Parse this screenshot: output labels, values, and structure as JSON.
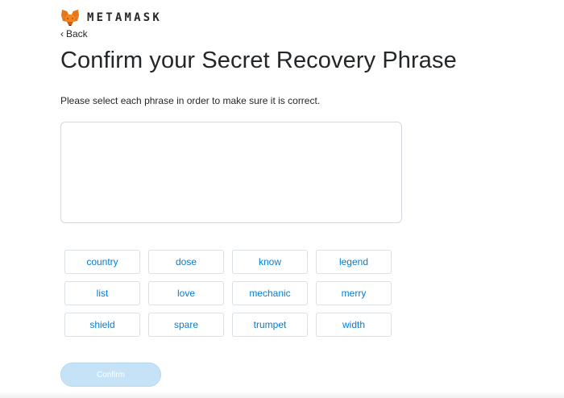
{
  "brand": {
    "wordmark": "METAMASK",
    "logo_icon": "metamask-fox-icon"
  },
  "nav": {
    "back_label": "Back",
    "back_icon": "chevron-left-icon"
  },
  "page": {
    "title": "Confirm your Secret Recovery Phrase",
    "instructions": "Please select each phrase in order to make sure it is correct."
  },
  "words": [
    "country",
    "dose",
    "know",
    "legend",
    "list",
    "love",
    "mechanic",
    "merry",
    "shield",
    "spare",
    "trumpet",
    "width"
  ],
  "actions": {
    "confirm_label": "Confirm",
    "confirm_disabled": true
  },
  "colors": {
    "accent": "#037dd6",
    "text": "#24272a",
    "confirm_disabled_bg": "#c6e2f6",
    "fox_orange": "#e2761b"
  }
}
